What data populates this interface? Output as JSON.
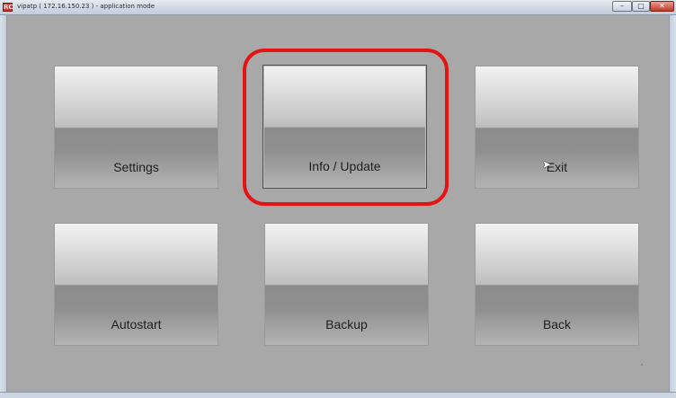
{
  "window": {
    "title": "vipatp ( 172.16.150.23 ) - application mode",
    "app_icon_text": "RC",
    "minimize_glyph": "–",
    "maximize_glyph": "□",
    "close_glyph": "✕"
  },
  "tiles": [
    {
      "label": "Settings"
    },
    {
      "label": "Info / Update",
      "selected": true
    },
    {
      "label": "Exit"
    },
    {
      "label": "Autostart"
    },
    {
      "label": "Backup"
    },
    {
      "label": "Back"
    }
  ],
  "colors": {
    "background": "#a8a8a8",
    "highlight": "#e31414",
    "close_button": "#c33b2a"
  },
  "icons": {
    "cursor": "mouse-pointer-icon"
  }
}
